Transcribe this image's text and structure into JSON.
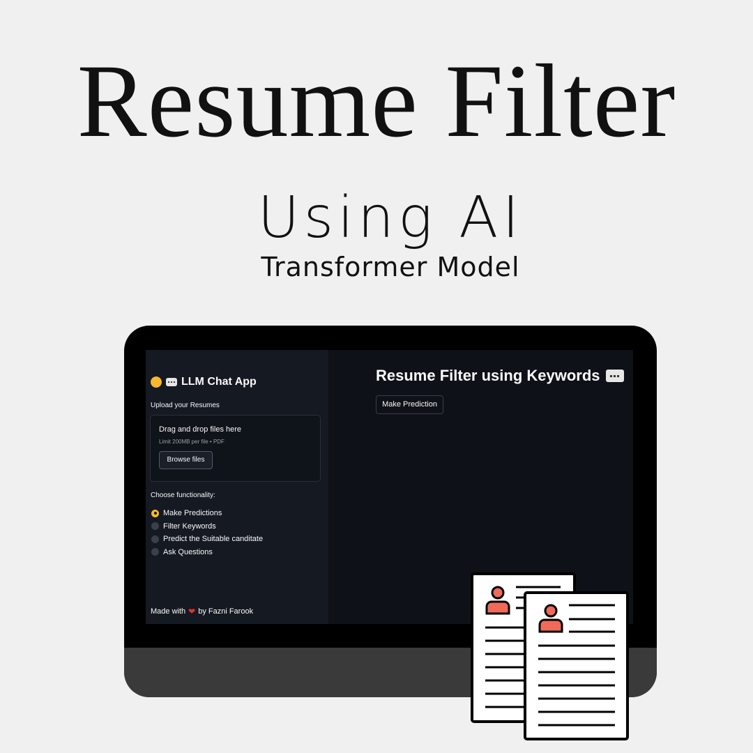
{
  "poster": {
    "headline": "Resume Filter",
    "subline": "Using AI",
    "model_line": "Transformer Model"
  },
  "sidebar": {
    "app_title": "LLM Chat App",
    "upload_label": "Upload your Resumes",
    "dropzone": {
      "title": "Drag and drop files here",
      "limit": "Limit 200MB per file • PDF",
      "browse_label": "Browse files"
    },
    "choose_label": "Choose functionality:",
    "options": [
      {
        "label": "Make Predictions",
        "checked": true
      },
      {
        "label": "Filter Keywords",
        "checked": false
      },
      {
        "label": "Predict the Suitable canditate",
        "checked": false
      },
      {
        "label": "Ask Questions",
        "checked": false
      }
    ],
    "footer_prefix": "Made with",
    "footer_suffix": "by Fazni Farook"
  },
  "main": {
    "title": "Resume Filter using Keywords",
    "predict_button": "Make Prediction"
  },
  "colors": {
    "accent": "#f5b82e",
    "heart": "#e5312b",
    "icon_person": "#f06a5a"
  },
  "icons": [
    "smiling-face-icon",
    "speech-bubble-icon",
    "heart-icon",
    "resume-documents-icon"
  ]
}
